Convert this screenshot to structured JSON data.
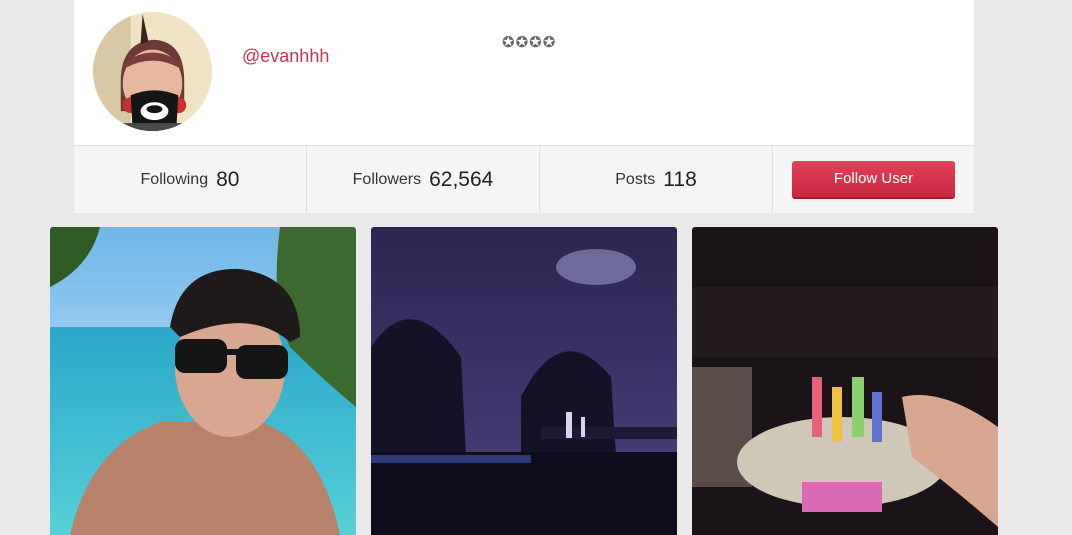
{
  "profile": {
    "username": "@evanhhh",
    "bio": "✪✪✪✪"
  },
  "stats": {
    "following_label": "Following",
    "following_value": "80",
    "followers_label": "Followers",
    "followers_value": "62,564",
    "posts_label": "Posts",
    "posts_value": "118"
  },
  "actions": {
    "follow_label": "Follow User"
  },
  "colors": {
    "accent": "#c9354c",
    "button": "#d9364f",
    "background": "#e9e9e9"
  }
}
